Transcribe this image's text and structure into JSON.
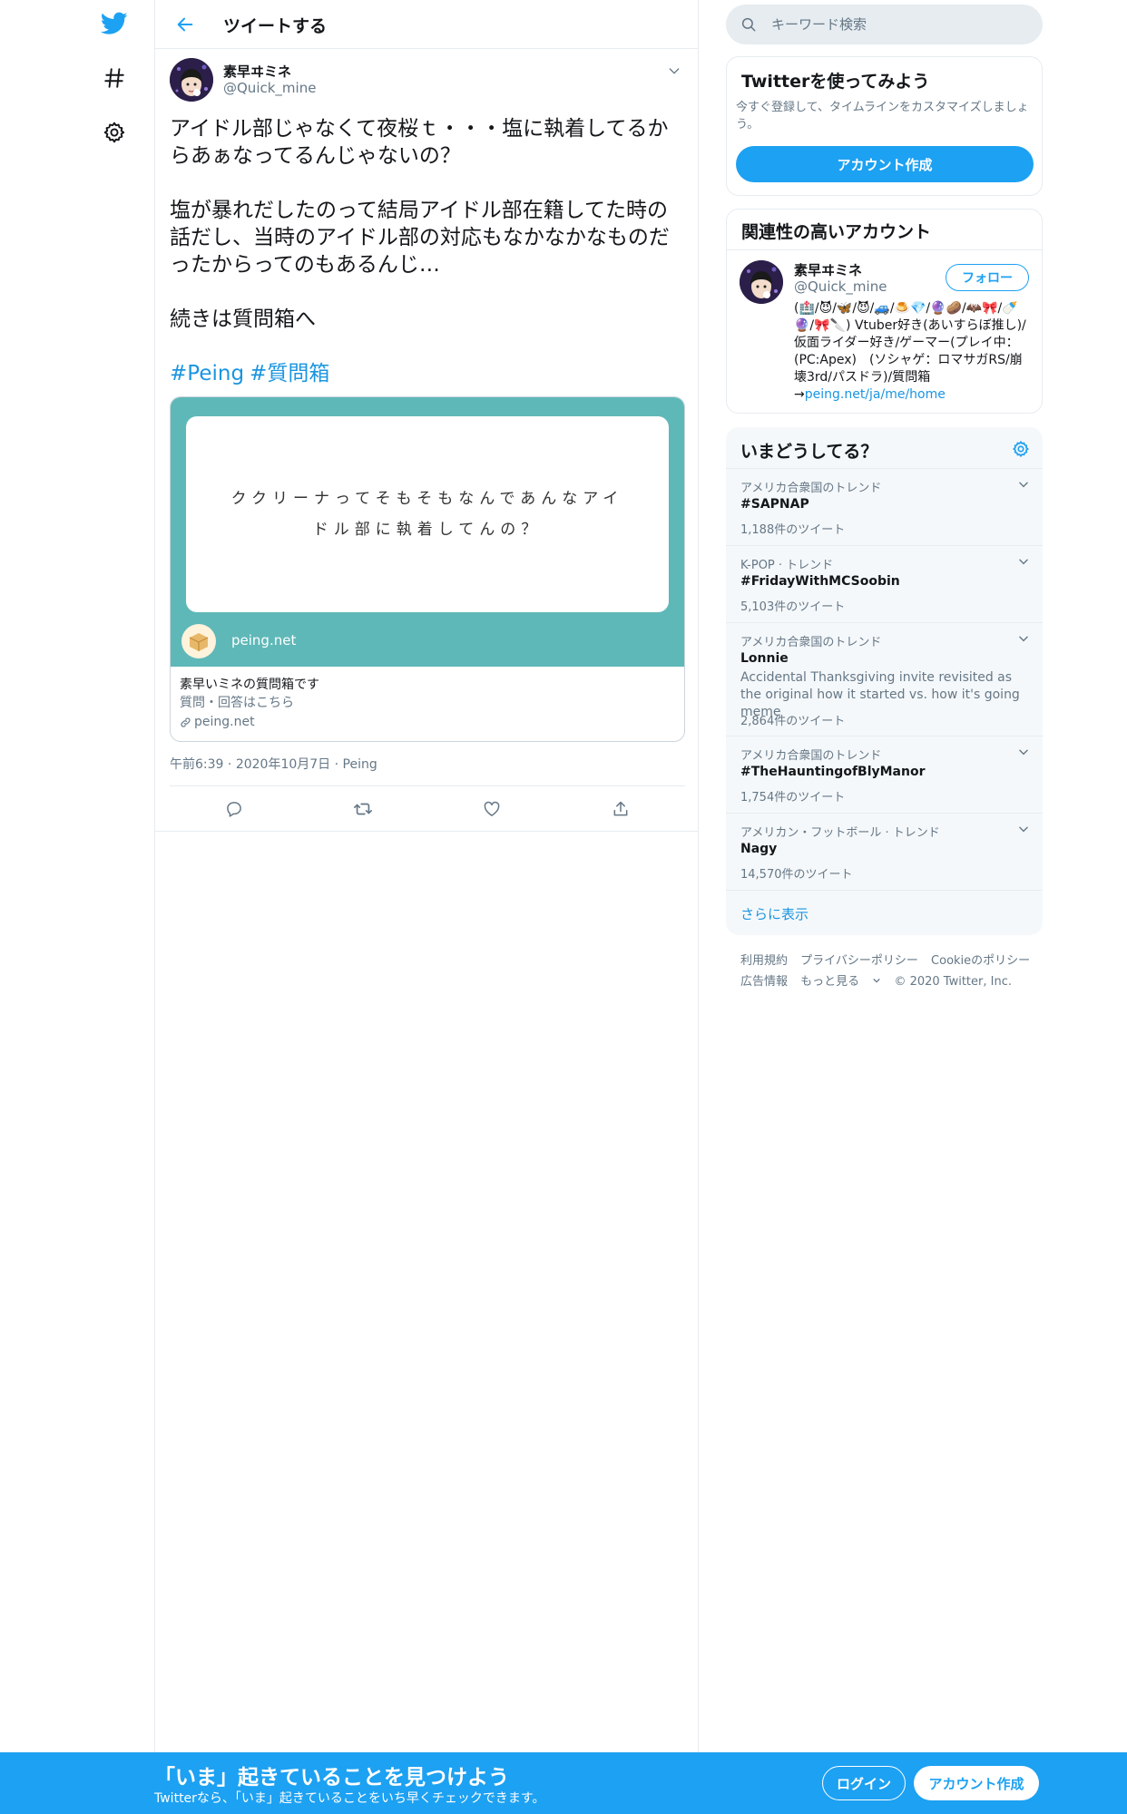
{
  "nav": {
    "logo_icon": "twitter-bird-icon",
    "explore_icon": "hashtag-icon",
    "settings_icon": "gear-icon",
    "brand_color": "#1da1f2"
  },
  "header": {
    "back_icon": "arrow-left-icon",
    "title": "ツイートする"
  },
  "tweet": {
    "author_name": "素早ヰミネ",
    "author_handle": "@Quick_mine",
    "paragraphs": [
      "アイドル部じゃなくて夜桜ｔ・・・塩に執着してるからあぁなってるんじゃないの？",
      "塩が暴れだしたのって結局アイドル部在籍してた時の話だし、当時のアイドル部の対応もなかなかなものだったからってのもあるんじ…",
      "続きは質問箱へ"
    ],
    "hashtags": [
      "#Peing",
      "#質問箱"
    ],
    "card": {
      "question": "ククリーナってそもそもなんであんなアイドル部に執着してんの？",
      "image_domain": "peing.net",
      "title": "素早いミネの質問箱です",
      "description": "質問・回答はこちら",
      "domain": "peing.net",
      "bg_color": "#5fb8b8"
    },
    "time": "午前6:39",
    "date": "2020年10月7日",
    "source": "Peing",
    "actions": [
      "reply-icon",
      "retweet-icon",
      "like-icon",
      "share-icon"
    ]
  },
  "search": {
    "placeholder": "キーワード検索"
  },
  "signup": {
    "title": "Twitterを使ってみよう",
    "description": "今すぐ登録して、タイムラインをカスタマイズしましょう。",
    "button": "アカウント作成"
  },
  "related": {
    "title": "関連性の高いアカウント",
    "name": "素早ヰミネ",
    "handle": "@Quick_mine",
    "follow": "フォロー",
    "bio_emoji": "(🏥/😈/🦋/😈/🚙/🍮💎/🔮🥔/🦇🎀/🍼🔮/🎀🔪)",
    "bio": "Vtuber好き(あいすらぼ推し)/仮面ライダー好き/ゲーマー(プレイ中：(PC:Apex)　(ソシャゲ：ロマサガRS/崩壊3rd/パスドラ)/質問箱→",
    "bio_link": "peing.net/ja/me/home"
  },
  "trends": {
    "title": "いまどうしてる？",
    "settings_icon": "gear-icon",
    "items": [
      {
        "context": "アメリカ合衆国のトレンド",
        "name": "#SAPNAP",
        "count": "1,188件のツイート"
      },
      {
        "context": "K-POP · トレンド",
        "name": "#FridayWithMCSoobin",
        "count": "5,103件のツイート"
      },
      {
        "context": "アメリカ合衆国のトレンド",
        "name": "Lonnie",
        "description": "Accidental Thanksgiving invite revisited as the original how it started vs. how it's going meme",
        "count": "2,864件のツイート"
      },
      {
        "context": "アメリカ合衆国のトレンド",
        "name": "#TheHauntingofBlyManor",
        "count": "1,754件のツイート"
      },
      {
        "context": "アメリカン・フットボール · トレンド",
        "name": "Nagy",
        "count": "14,570件のツイート"
      }
    ],
    "show_more": "さらに表示"
  },
  "footer": {
    "links": [
      "利用規約",
      "プライバシーポリシー",
      "Cookieのポリシー",
      "広告情報",
      "もっと見る"
    ],
    "copyright": "© 2020 Twitter, Inc."
  },
  "banner": {
    "title": "「いま」起きていることを見つけよう",
    "subtitle": "Twitterなら、「いま」起きていることをいち早くチェックできます。",
    "login": "ログイン",
    "signup": "アカウント作成"
  }
}
